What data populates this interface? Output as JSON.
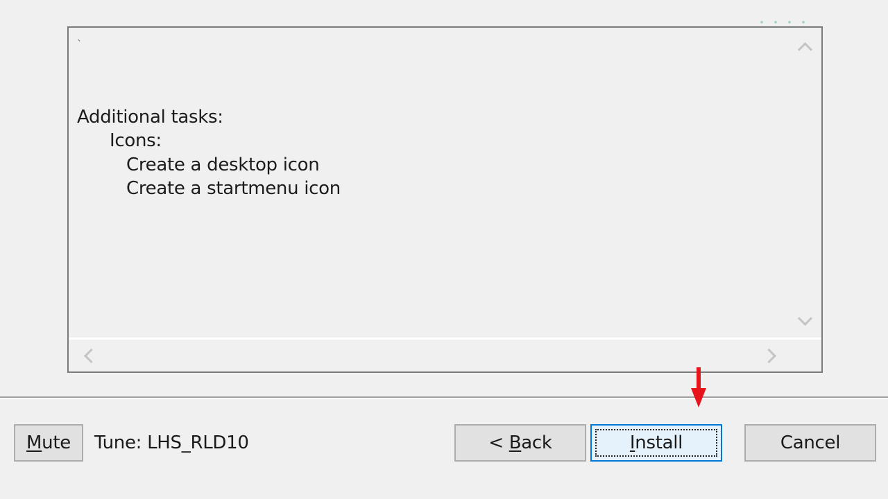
{
  "summary": {
    "tick": "ˎ",
    "lines": [
      {
        "text": "Additional tasks:",
        "indent": 0
      },
      {
        "text": "Icons:",
        "indent": 1
      },
      {
        "text": "Create a desktop icon",
        "indent": 2
      },
      {
        "text": "Create a startmenu icon",
        "indent": 2
      }
    ]
  },
  "footer": {
    "mute": {
      "accel": "M",
      "rest": "ute"
    },
    "tune_label": "Tune: LHS_RLD10",
    "back": {
      "prefix": "< ",
      "accel": "B",
      "rest": "ack"
    },
    "install": {
      "accel": "I",
      "rest": "nstall"
    },
    "cancel_label": "Cancel"
  },
  "annotation": {
    "arrow_color": "#e8141c"
  },
  "colors": {
    "focus_border": "#0078d7",
    "button_bg": "#e1e1e1",
    "window_bg": "#f0f0f0"
  },
  "icons": {
    "scroll_up": "chevron-up-icon",
    "scroll_down": "chevron-down-icon",
    "scroll_left": "chevron-left-icon",
    "scroll_right": "chevron-right-icon",
    "pointer": "red-arrow-down-icon"
  }
}
